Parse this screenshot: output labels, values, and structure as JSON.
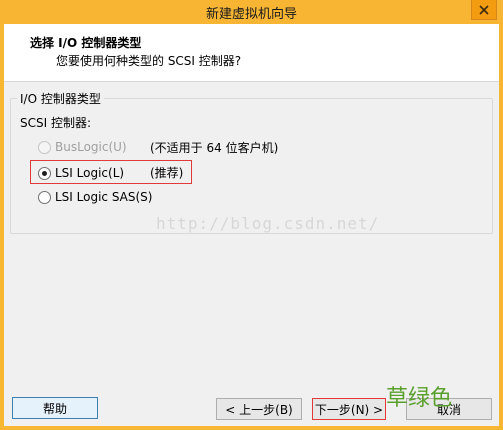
{
  "window": {
    "title": "新建虚拟机向导"
  },
  "header": {
    "title": "选择 I/O 控制器类型",
    "subtitle": "您要使用何种类型的 SCSI 控制器?"
  },
  "group": {
    "legend": "I/O 控制器类型"
  },
  "scsi": {
    "label": "SCSI 控制器:",
    "options": [
      {
        "label": "BusLogic(U)",
        "note": "(不适用于 64 位客户机)",
        "checked": false,
        "disabled": true
      },
      {
        "label": "LSI Logic(L)",
        "note": "(推荐)",
        "checked": true,
        "disabled": false
      },
      {
        "label": "LSI Logic SAS(S)",
        "note": "",
        "checked": false,
        "disabled": false
      }
    ]
  },
  "watermark": "http://blog.csdn.net/",
  "footer": {
    "help": "帮助",
    "back": "< 上一步(B)",
    "next": "下一步(N) >",
    "cancel": "取消"
  },
  "brand": "草绿色"
}
